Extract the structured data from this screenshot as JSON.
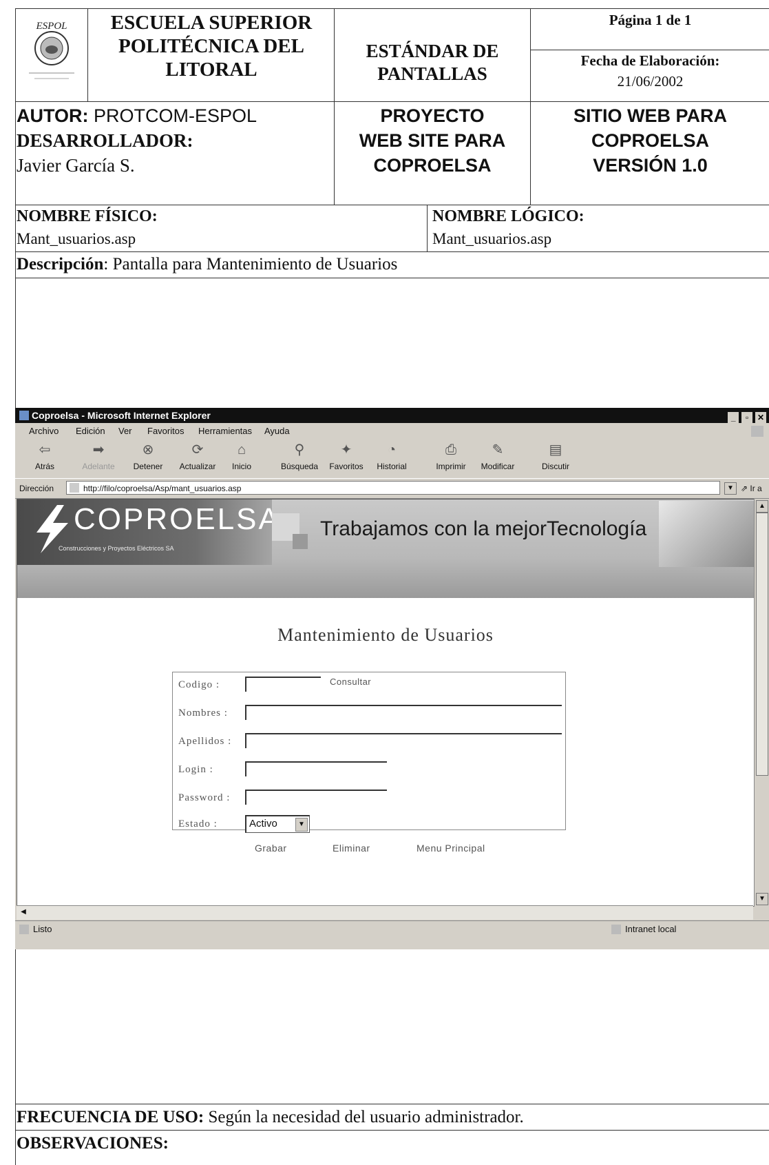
{
  "header": {
    "institution": [
      "ESCUELA SUPERIOR",
      "POLITÉCNICA DEL",
      "LITORAL"
    ],
    "logo_text": "ESPOL",
    "document_type": [
      "ESTÁNDAR DE",
      "PANTALLAS"
    ],
    "page": "Página 1 de 1",
    "date_label": "Fecha de Elaboración:",
    "date_value": "21/06/2002"
  },
  "authors": {
    "autor_label": "AUTOR:",
    "autor_value": " PROTCOM-ESPOL",
    "dev_label": "DESARROLLADOR:",
    "dev_value": "Javier García S.",
    "project": [
      "PROYECTO",
      "WEB SITE  PARA",
      "COPROELSA"
    ],
    "site": [
      "SITIO WEB PARA",
      "COPROELSA",
      "VERSIÓN 1.0"
    ]
  },
  "names": {
    "physical_label": "NOMBRE FÍSICO:",
    "physical_value": "Mant_usuarios.asp",
    "logical_label": "NOMBRE LÓGICO:",
    "logical_value": "Mant_usuarios.asp"
  },
  "description": {
    "label": "Descripción",
    "value": ": Pantalla para Mantenimiento de Usuarios"
  },
  "browser": {
    "title": "Coproelsa - Microsoft Internet Explorer",
    "menu": [
      "Archivo",
      "Edición",
      "Ver",
      "Favoritos",
      "Herramientas",
      "Ayuda"
    ],
    "toolbar": [
      "Atrás",
      "Adelante",
      "Detener",
      "Actualizar",
      "Inicio",
      "Búsqueda",
      "Favoritos",
      "Historial",
      "Imprimir",
      "Modificar",
      "Discutir"
    ],
    "address_label": "Dirección",
    "address_value": "http://filo/coproelsa/Asp/mant_usuarios.asp",
    "go_label": "Ir a",
    "status_text": "Listo",
    "zone_text": "Intranet local"
  },
  "site": {
    "logo": "COPROELSA",
    "logo_sub": "Construcciones y Proyectos Eléctricos SA",
    "tagline": "Trabajamos con la mejorTecnología",
    "form_title": "Mantenimiento de Usuarios",
    "fields": {
      "codigo": "Codigo :",
      "nombres": "Nombres :",
      "apellidos": "Apellidos :",
      "login": "Login :",
      "password": "Password :",
      "estado": "Estado :"
    },
    "consultar": "Consultar",
    "estado_value": "Activo",
    "actions": [
      "Grabar",
      "Eliminar",
      "Menu Principal"
    ]
  },
  "footer": {
    "freq_label": "FRECUENCIA DE USO:",
    "freq_value": " Según la necesidad del usuario administrador.",
    "obs_label": "OBSERVACIONES:"
  }
}
